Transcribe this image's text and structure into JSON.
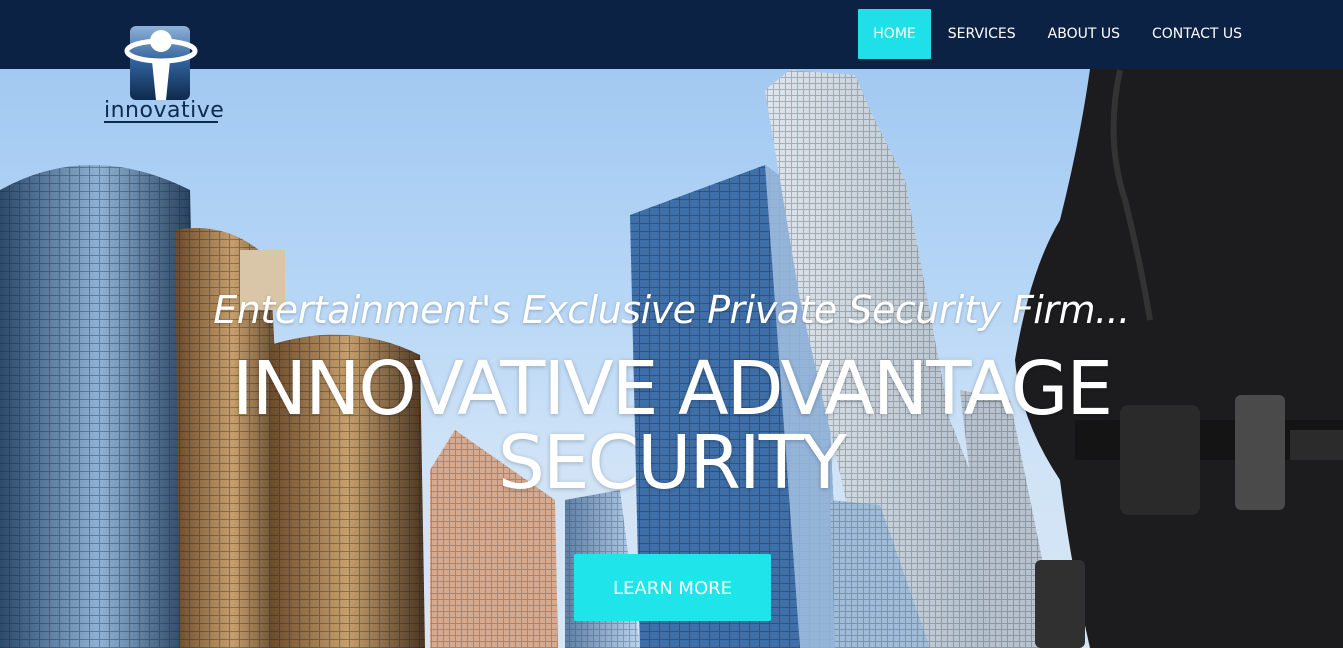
{
  "brand": {
    "logo_text": "innovative",
    "logo_icon": "shield-person-icon"
  },
  "nav": {
    "items": [
      {
        "label": "HOME",
        "active": true
      },
      {
        "label": "SERVICES",
        "active": false
      },
      {
        "label": "ABOUT US",
        "active": false
      },
      {
        "label": "CONTACT US",
        "active": false
      }
    ]
  },
  "hero": {
    "tagline": "Entertainment's Exclusive Private Security Firm...",
    "headline_line1": "INNOVATIVE ADVANTAGE",
    "headline_line2": "SECURITY",
    "cta_label": "LEARN MORE"
  },
  "colors": {
    "topbar": "#0b2244",
    "accent": "#1fe4ea",
    "text_on_dark": "#ffffff"
  }
}
